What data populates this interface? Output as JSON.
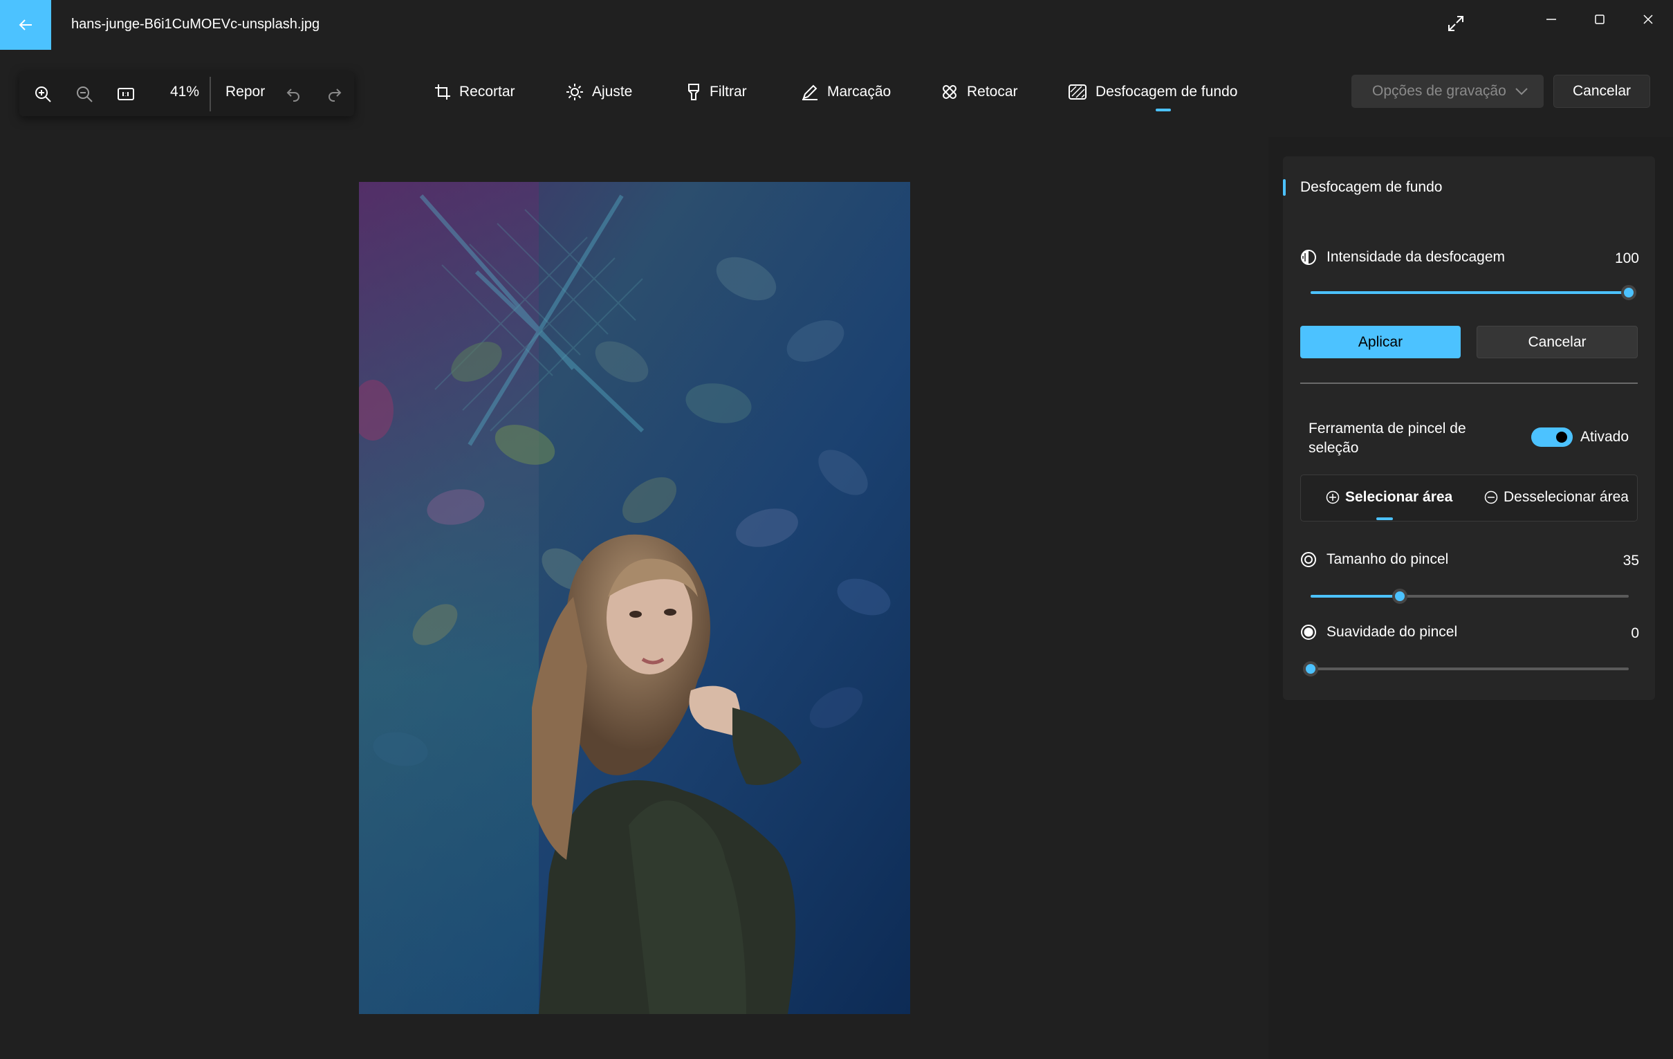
{
  "window": {
    "file_name": "hans-junge-B6i1CuMOEVc-unsplash.jpg",
    "back_icon": "arrow-left-icon",
    "buttons": [
      "expand-icon",
      "minimize-icon",
      "maximize-icon",
      "close-icon"
    ]
  },
  "zoom_toolbar": {
    "zoom_in_icon": "zoom-in-icon",
    "zoom_out_icon": "zoom-out-icon",
    "actual_size_icon": "actual-size-icon",
    "zoom_level": "41%",
    "reset_label": "Repor",
    "undo_icon": "undo-icon",
    "redo_icon": "redo-icon"
  },
  "edit_tabs": [
    {
      "label": "Recortar",
      "icon": "crop-icon"
    },
    {
      "label": "Ajuste",
      "icon": "brightness-icon"
    },
    {
      "label": "Filtrar",
      "icon": "filter-icon"
    },
    {
      "label": "Marcação",
      "icon": "pen-icon"
    },
    {
      "label": "Retocar",
      "icon": "retouch-icon"
    },
    {
      "label": "Desfocagem de fundo",
      "icon": "background-blur-icon",
      "active": true
    }
  ],
  "save_options": {
    "label": "Opções de gravação",
    "disabled": true
  },
  "cancel_top": "Cancelar",
  "panel": {
    "title": "Desfocagem de fundo",
    "blur_intensity": {
      "label": "Intensidade da desfocagem",
      "value": "100",
      "fraction": 1.0
    },
    "apply_label": "Aplicar",
    "cancel_label": "Cancelar",
    "brush_tool": {
      "label": "Ferramenta de pincel de seleção",
      "state_label": "Ativado",
      "on": true
    },
    "select_area": "Selecionar área",
    "deselect_area": "Desselecionar área",
    "brush_size": {
      "label": "Tamanho do pincel",
      "value": "35",
      "fraction": 0.28
    },
    "brush_softness": {
      "label": "Suavidade do pincel",
      "value": "0",
      "fraction": 0.0
    }
  },
  "colors": {
    "accent": "#4cc2ff",
    "background": "#202020",
    "panel": "#262626"
  }
}
